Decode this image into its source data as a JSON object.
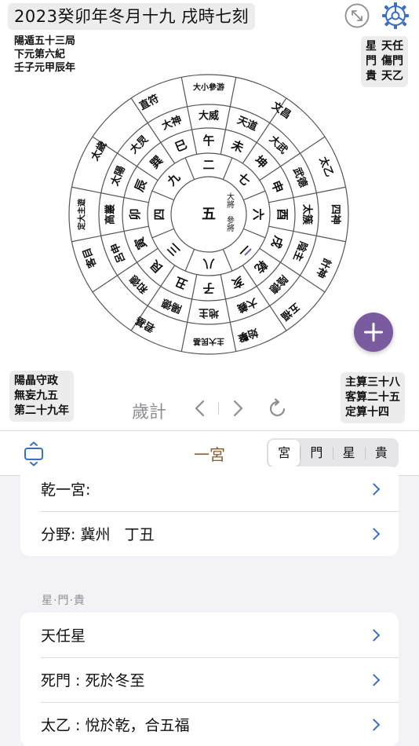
{
  "header": {
    "title": "2023癸卯年冬月十九 戌時七刻",
    "left_info": [
      "陽遁五十三局",
      "下元第六紀",
      "壬子元甲辰年"
    ],
    "right_info_col1": [
      "星",
      "門",
      "貴"
    ],
    "right_info_col2": [
      "天任",
      "傷門",
      "天乙"
    ],
    "icons": {
      "expand": "expand-icon",
      "settings": "gear-icon"
    }
  },
  "chart": {
    "center": "五",
    "center_side": "大將",
    "center_side2": "參將",
    "inner": [
      {
        "t": "二",
        "a": -90
      },
      {
        "t": "七",
        "a": -45
      },
      {
        "t": "六",
        "a": 0
      },
      {
        "t": "一",
        "a": 45
      },
      {
        "t": "八",
        "a": 90
      },
      {
        "t": "三",
        "a": 135
      },
      {
        "t": "四",
        "a": 180
      },
      {
        "t": "九",
        "a": -135
      }
    ],
    "ring2": [
      {
        "t": "午",
        "a": -90
      },
      {
        "t": "未",
        "a": -67
      },
      {
        "t": "坤",
        "a": -45
      },
      {
        "t": "申",
        "a": -22
      },
      {
        "t": "酉",
        "a": 0
      },
      {
        "t": "戌",
        "a": 22
      },
      {
        "t": "乾",
        "a": 45
      },
      {
        "t": "亥",
        "a": 67
      },
      {
        "t": "子",
        "a": 90
      },
      {
        "t": "丑",
        "a": 112
      },
      {
        "t": "艮",
        "a": 135
      },
      {
        "t": "寅",
        "a": 157
      },
      {
        "t": "卯",
        "a": 180
      },
      {
        "t": "辰",
        "a": -157
      },
      {
        "t": "巽",
        "a": -135
      },
      {
        "t": "巳",
        "a": -112
      }
    ],
    "ring3": [
      {
        "t": "大威",
        "a": -90
      },
      {
        "t": "天道",
        "a": -67
      },
      {
        "t": "大武",
        "a": -45
      },
      {
        "t": "武德",
        "a": -22
      },
      {
        "t": "太簇",
        "a": 0
      },
      {
        "t": "陰主",
        "a": 22
      },
      {
        "t": "陰德",
        "a": 45
      },
      {
        "t": "大義",
        "a": 67
      },
      {
        "t": "地主",
        "a": 90
      },
      {
        "t": "陽德",
        "a": 112
      },
      {
        "t": "和德",
        "a": 135
      },
      {
        "t": "呂申",
        "a": 157
      },
      {
        "t": "高叢",
        "a": 180
      },
      {
        "t": "太陽",
        "a": -157
      },
      {
        "t": "大炅",
        "a": -135
      },
      {
        "t": "大神",
        "a": -112
      }
    ],
    "ring4": [
      {
        "t": "大小參游",
        "a": -90
      },
      {
        "t": "文昌",
        "a": -55
      },
      {
        "t": "太乙",
        "a": -22
      },
      {
        "t": "四神",
        "a": 0
      },
      {
        "t": "計神",
        "a": 25
      },
      {
        "t": "五福",
        "a": 50
      },
      {
        "t": "始擊",
        "a": 72
      },
      {
        "t": "主大民基",
        "a": 90
      },
      {
        "t": "君基",
        "a": 120
      },
      {
        "t": "客目",
        "a": 160
      },
      {
        "t": "定大主遊",
        "a": 180
      },
      {
        "t": "太歲",
        "a": -150
      },
      {
        "t": "直符",
        "a": -118
      }
    ]
  },
  "bottom_left_info": [
    "陽晶守政",
    "無妄九五",
    "第二十九年"
  ],
  "bottom_right_info": [
    "主算三十八",
    "客算二十五",
    "定算十四"
  ],
  "controls": {
    "label": "歲計"
  },
  "tabbar": {
    "palace_title": "一宮",
    "segments": [
      "宮",
      "門",
      "星",
      "貴"
    ],
    "selected": "宮"
  },
  "card1": {
    "rows": [
      "乾一宮:",
      "分野: 冀州   丁丑"
    ]
  },
  "section_label": "星·門·貴",
  "card2": {
    "rows": [
      "天任星",
      "死門 : 死於冬至",
      "太乙 : 悅於乾，合五福"
    ]
  },
  "colors": {
    "accent": "#3a6fc4",
    "fab": "#7b5ba0",
    "palace_title": "#8a5a2b"
  }
}
